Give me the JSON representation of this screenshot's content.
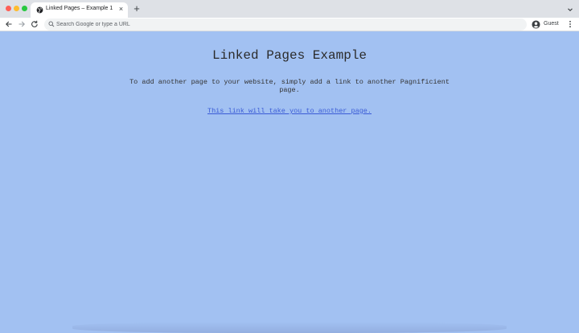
{
  "browser": {
    "tab": {
      "title": "Linked Pages – Example 1"
    },
    "omnibox": {
      "placeholder": "Search Google or type a URL"
    },
    "profile": {
      "label": "Guest"
    }
  },
  "page": {
    "heading": "Linked Pages Example",
    "paragraph": "To add another page to your website, simply add a link to another Pagnificient page.",
    "link_text": "This link will take you to another page."
  },
  "colors": {
    "page_background": "#a2c1f2",
    "link": "#3a5bd6",
    "tabstrip": "#dee1e6"
  }
}
